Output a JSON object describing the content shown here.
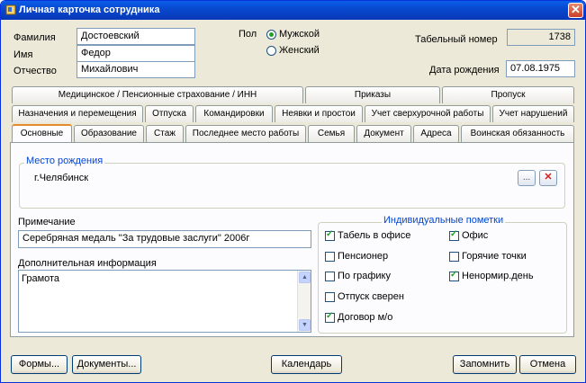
{
  "window": {
    "title": "Личная карточка сотрудника",
    "close_glyph": "✕"
  },
  "person": {
    "lastname_label": "Фамилия",
    "lastname_value": "Достоевский",
    "firstname_label": "Имя",
    "firstname_value": "Федор",
    "patronymic_label": "Отчество",
    "patronymic_value": "Михайлович",
    "gender_label": "Пол",
    "gender_male": "Мужской",
    "gender_female": "Женский",
    "gender_selected": "Мужской",
    "tabnum_label": "Табельный номер",
    "tabnum_value": "1738",
    "birthdate_label": "Дата рождения",
    "birthdate_value": "07.08.1975"
  },
  "tabs": {
    "row1": [
      "Медицинское / Пенсионные страхование / ИНН",
      "Приказы",
      "Пропуск"
    ],
    "row2": [
      "Назначения и перемещения",
      "Отпуска",
      "Командировки",
      "Неявки и простои",
      "Учет сверхурочной работы",
      "Учет нарушений"
    ],
    "row3": [
      "Основные",
      "Образование",
      "Стаж",
      "Последнее место работы",
      "Семья",
      "Документ",
      "Адреса",
      "Воинская обязанность"
    ],
    "active": "Основные"
  },
  "main": {
    "birthplace_legend": "Место рождения",
    "birthplace_value": "г.Челябинск",
    "browse_glyph": "...",
    "clear_glyph": "✕",
    "note_label": "Примечание",
    "note_value": "Серебряная медаль \"За трудовые заслуги\" 2006г",
    "extra_label": "Дополнительная информация",
    "extra_value": "Грамота",
    "marks_legend": "Индивидуальные пометки",
    "marks_left": [
      {
        "label": "Табель в офисе",
        "checked": true
      },
      {
        "label": "Пенсионер",
        "checked": false
      },
      {
        "label": "По графику",
        "checked": false
      },
      {
        "label": "Отпуск сверен",
        "checked": false
      },
      {
        "label": "Договор м/о",
        "checked": true
      }
    ],
    "marks_right": [
      {
        "label": "Офис",
        "checked": true
      },
      {
        "label": "Горячие точки",
        "checked": false
      },
      {
        "label": "Ненормир.день",
        "checked": true
      }
    ]
  },
  "buttons": {
    "forms": "Формы...",
    "documents": "Документы...",
    "calendar": "Календарь",
    "save": "Запомнить",
    "cancel": "Отмена"
  }
}
